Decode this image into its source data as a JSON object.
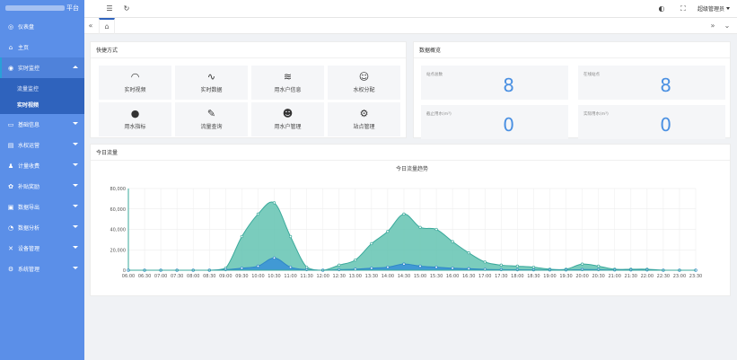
{
  "app": {
    "title_suffix": "平台"
  },
  "sidebar": {
    "items": [
      {
        "label": "仪表盘",
        "icon": "dashboard-icon",
        "glyph": "◎",
        "caret": ""
      },
      {
        "label": "主页",
        "icon": "home-icon",
        "glyph": "⌂",
        "caret": ""
      },
      {
        "label": "实时监控",
        "icon": "location-icon",
        "glyph": "◉",
        "caret": "up",
        "active": true
      },
      {
        "label": "基础信息",
        "icon": "card-icon",
        "glyph": "▭",
        "caret": "down"
      },
      {
        "label": "水权运营",
        "icon": "folder-icon",
        "glyph": "▤",
        "caret": "down"
      },
      {
        "label": "计量收费",
        "icon": "users-icon",
        "glyph": "♟",
        "caret": "down"
      },
      {
        "label": "补贴奖励",
        "icon": "gift-icon",
        "glyph": "✿",
        "caret": "down"
      },
      {
        "label": "数据导出",
        "icon": "export-icon",
        "glyph": "▣",
        "caret": "down"
      },
      {
        "label": "数据分析",
        "icon": "chart-icon",
        "glyph": "◔",
        "caret": "down"
      },
      {
        "label": "设备管理",
        "icon": "tools-icon",
        "glyph": "✕",
        "caret": "down"
      },
      {
        "label": "系统管理",
        "icon": "settings-icon",
        "glyph": "⚙",
        "caret": "down"
      }
    ],
    "sub_items": [
      {
        "label": "流量监控"
      },
      {
        "label": "实时视频",
        "current": true
      }
    ]
  },
  "topbar": {
    "user_label": "超级管理员"
  },
  "quick": {
    "title": "快捷方式",
    "items": [
      {
        "label": "实时视频",
        "icon": "gauge-icon",
        "glyph": "◠"
      },
      {
        "label": "实时数据",
        "icon": "pulse-icon",
        "glyph": "∿"
      },
      {
        "label": "用水户信息",
        "icon": "layers-icon",
        "glyph": "≋"
      },
      {
        "label": "水权分配",
        "icon": "smile-icon",
        "glyph": "☺"
      },
      {
        "label": "用水指标",
        "icon": "compass-icon",
        "glyph": "●"
      },
      {
        "label": "流量查询",
        "icon": "edit-icon",
        "glyph": "✎"
      },
      {
        "label": "用水户管理",
        "icon": "user-icon",
        "glyph": "☻"
      },
      {
        "label": "站点管理",
        "icon": "gear-icon",
        "glyph": "⚙"
      }
    ]
  },
  "overview": {
    "title": "数据概览",
    "cells": [
      {
        "label": "站点总数",
        "value": "8"
      },
      {
        "label": "在线站点",
        "value": "8"
      },
      {
        "label": "截止用水(m³)",
        "value": "0"
      },
      {
        "label": "实际用水(m³)",
        "value": "0"
      }
    ]
  },
  "flow": {
    "title": "今日流量"
  },
  "chart_data": {
    "type": "area",
    "title": "今日流量趋势",
    "xlabel": "",
    "ylabel": "",
    "ylim": [
      0,
      80000
    ],
    "yticks": [
      "0",
      "20,000",
      "40,000",
      "60,000",
      "80,000"
    ],
    "grid": true,
    "categories": [
      "06:00",
      "06:30",
      "07:00",
      "07:30",
      "08:00",
      "08:30",
      "09:00",
      "09:30",
      "10:00",
      "10:30",
      "11:00",
      "11:30",
      "12:00",
      "12:30",
      "13:00",
      "13:30",
      "14:00",
      "14:30",
      "15:00",
      "15:30",
      "16:00",
      "16:30",
      "17:00",
      "17:30",
      "18:00",
      "18:30",
      "19:00",
      "19:30",
      "20:00",
      "20:30",
      "21:00",
      "21:30",
      "22:00",
      "22:30",
      "23:00",
      "23:30"
    ],
    "series": [
      {
        "color": "#3aa99b",
        "fill": "#63c3b1",
        "values": [
          0,
          0,
          0,
          0,
          0,
          0,
          2000,
          33000,
          55000,
          66000,
          33000,
          3000,
          0,
          5000,
          10000,
          26000,
          38000,
          55000,
          42000,
          40000,
          28000,
          17000,
          8000,
          5000,
          4000,
          3000,
          1000,
          1000,
          6000,
          4000,
          1000,
          1000,
          1000,
          0,
          0,
          0
        ]
      },
      {
        "color": "#2e86c8",
        "fill": "#3b93d6",
        "values": [
          0,
          0,
          0,
          0,
          0,
          0,
          500,
          2000,
          4000,
          12000,
          3000,
          500,
          0,
          500,
          1000,
          2000,
          3000,
          6000,
          4000,
          3000,
          2000,
          1500,
          800,
          500,
          400,
          300,
          200,
          200,
          600,
          500,
          200,
          200,
          200,
          0,
          0,
          0
        ]
      }
    ]
  }
}
